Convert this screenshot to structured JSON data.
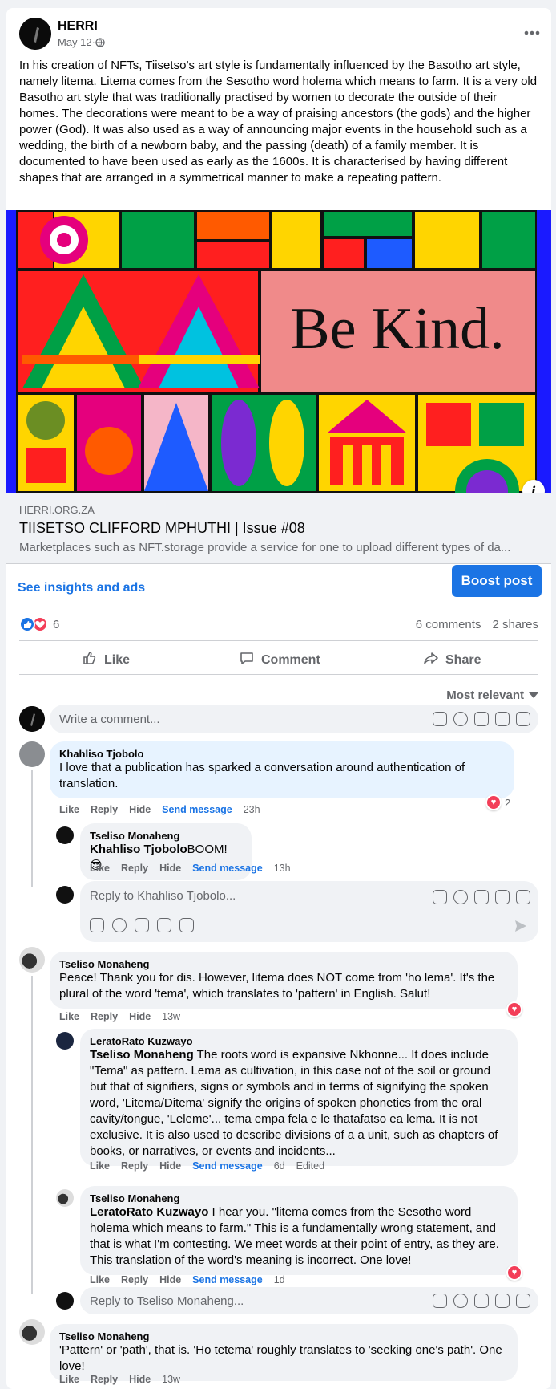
{
  "post": {
    "author": "HERRI",
    "date": "May 12",
    "sep": " · ",
    "text": "In his creation of NFTs, Tiisetso’s art style is fundamentally influenced by the Basotho art style, namely litema. Litema comes from the Sesotho word holema which means to farm. It is a very old Basotho art style that was traditionally practised by women to decorate the outside of their homes. The decorations were meant to be a way of praising ancestors (the gods) and the higher power (God). It was also used as a way of announcing major events in the household such as a wedding, the birth of a newborn baby, and the passing (death) of a family member. It is documented to have been used as early as the 1600s. It is characterised by having different shapes that are arranged in a symmetrical manner to make a repeating pattern.",
    "more_icon": "more-horizontal-icon"
  },
  "link": {
    "image_text": "Be Kind.",
    "domain": "HERRI.ORG.ZA",
    "title": "TIISETSO CLIFFORD MPHUTHI | Issue #08",
    "description": "Marketplaces such as NFT.storage provide a service for one to upload different types of da..."
  },
  "insights": {
    "link": "See insights and ads",
    "boost": "Boost post"
  },
  "stats": {
    "reactions": "6",
    "comments": "6 comments",
    "shares": "2 shares"
  },
  "actions": {
    "like": "Like",
    "comment": "Comment",
    "share": "Share"
  },
  "sort": {
    "label": "Most relevant"
  },
  "composer": {
    "placeholder": "Write a comment..."
  },
  "comments": [
    {
      "name": "Khahliso Tjobolo",
      "text": "I love that a publication has sparked a conversation around authentication of translation.",
      "like": "Like",
      "reply": "Reply",
      "hide": "Hide",
      "send": "Send message",
      "time": "23h",
      "reaction_count": "2",
      "replies": [
        {
          "name": "Tseliso Monaheng",
          "mention": "Khahliso Tjobolo",
          "text": "BOOM! 😎",
          "like": "Like",
          "reply": "Reply",
          "hide": "Hide",
          "send": "Send message",
          "time": "13h"
        }
      ],
      "reply_placeholder": "Reply to Khahliso Tjobolo..."
    },
    {
      "name": "Tseliso Monaheng",
      "text": "Peace! Thank you for dis. However, litema does NOT come from 'ho lema'. It's the plural of the word 'tema', which translates to 'pattern' in English. Salut!",
      "like": "Like",
      "reply": "Reply",
      "hide": "Hide",
      "time": "13w",
      "replies": [
        {
          "name": "LeratoRato Kuzwayo",
          "mention": "Tseliso Monaheng",
          "text": " The roots word is expansive Nkhonne... It does include \"Tema\" as pattern. Lema as cultivation, in this case not of the soil or ground but that of signifiers, signs or symbols and in terms of signifying the spoken word, 'Litema/Ditema' signify the origins of spoken phonetics from the oral cavity/tongue, 'Leleme'... tema empa fela e le thatafatso ea lema. It is not exclusive. It is also used to describe divisions of a a unit, such as chapters of books, or narratives, or events and incidents...",
          "like": "Like",
          "reply": "Reply",
          "hide": "Hide",
          "send": "Send message",
          "time": "6d",
          "edited": "Edited"
        },
        {
          "name": "Tseliso Monaheng",
          "mention": "LeratoRato Kuzwayo",
          "text": " I hear you. \"litema comes from the Sesotho word holema which means to farm.\" This is a fundamentally wrong statement, and that is what I'm contesting. We meet words at their point of entry, as they are. This translation of the word's meaning is incorrect. One love!",
          "like": "Like",
          "reply": "Reply",
          "hide": "Hide",
          "send": "Send message",
          "time": "1d"
        }
      ],
      "reply_placeholder": "Reply to Tseliso Monaheng..."
    },
    {
      "name": "Tseliso Monaheng",
      "text": "'Pattern' or 'path', that is. 'Ho tetema' roughly translates to 'seeking one's path'. One love!",
      "like": "Like",
      "reply": "Reply",
      "hide": "Hide",
      "time": "13w"
    }
  ]
}
